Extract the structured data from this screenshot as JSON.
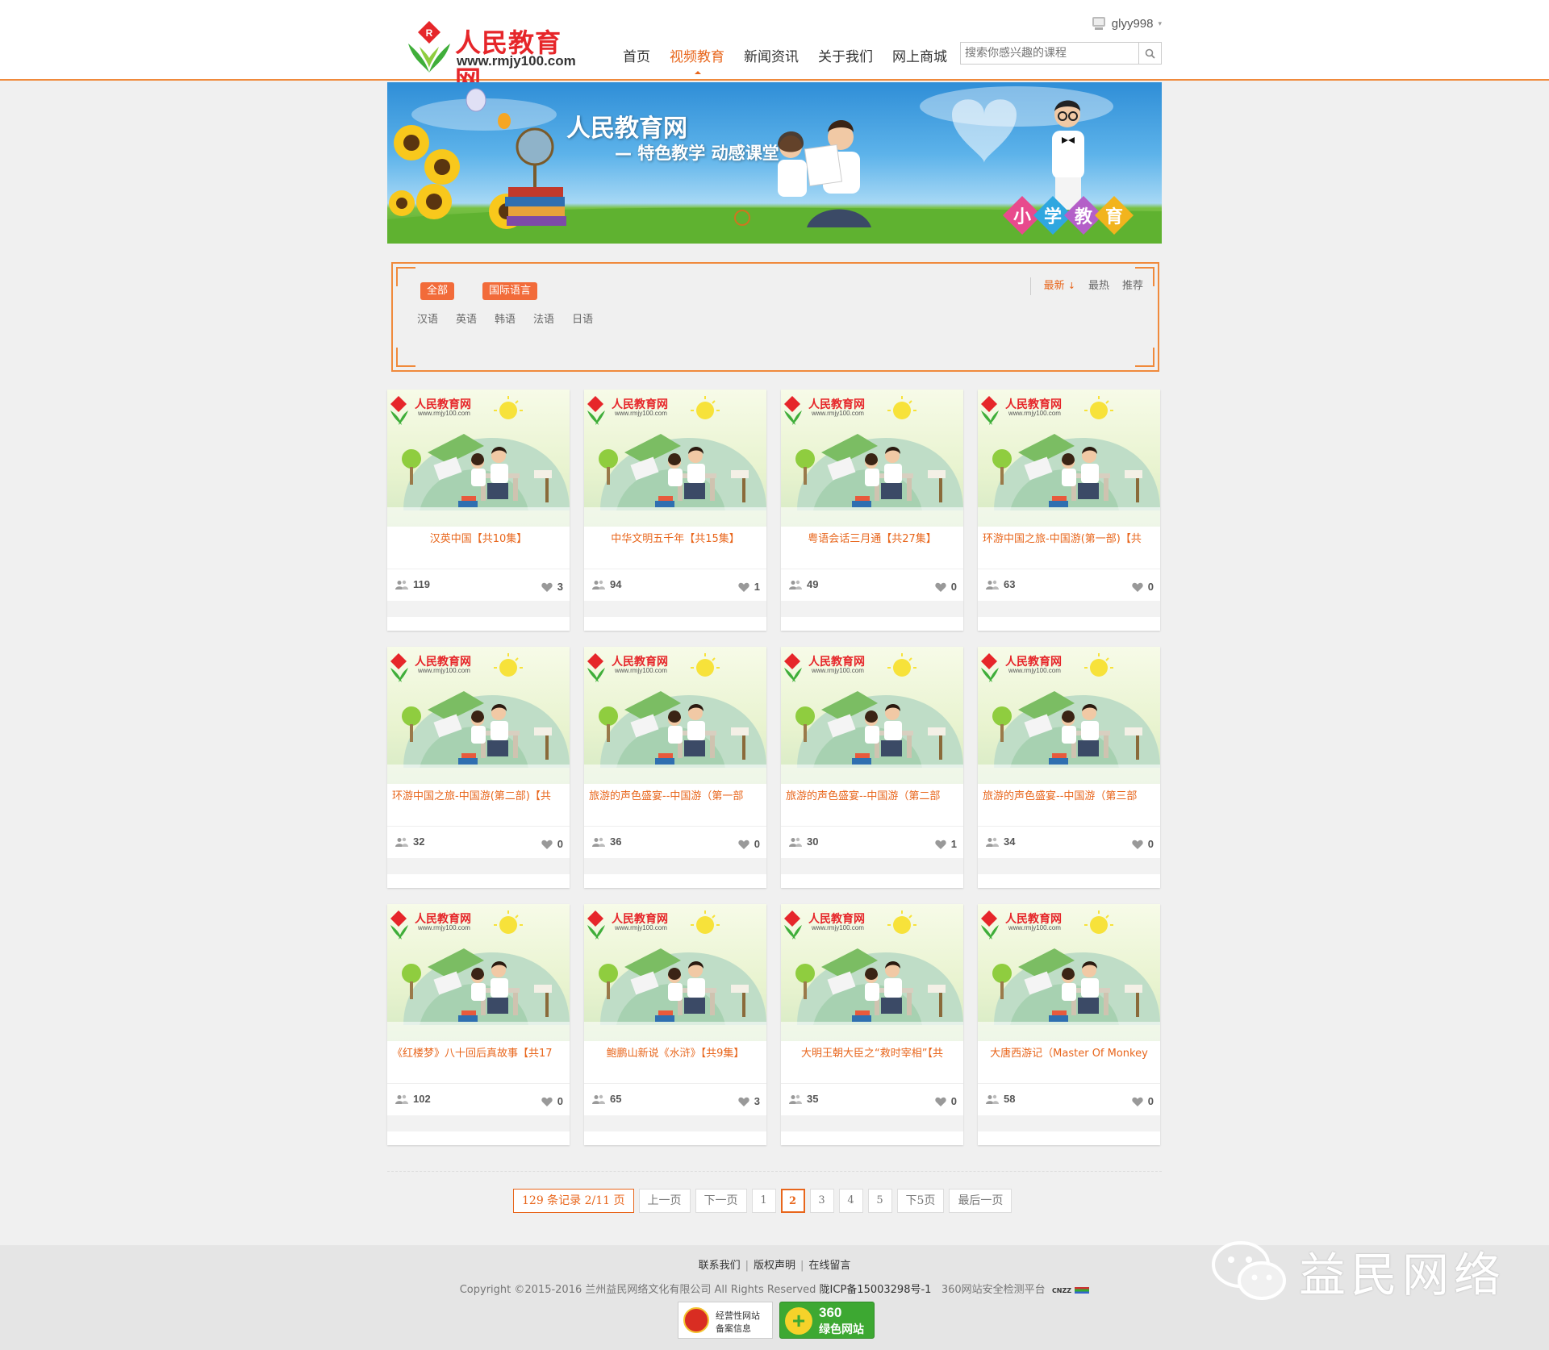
{
  "header": {
    "logo_title": "人民教育网",
    "logo_url": "www.rmjy100.com",
    "nav": [
      {
        "label": "首页",
        "active": false
      },
      {
        "label": "视频教育",
        "active": true
      },
      {
        "label": "新闻资讯",
        "active": false
      },
      {
        "label": "关于我们",
        "active": false
      },
      {
        "label": "网上商城",
        "active": false
      }
    ],
    "username": "glyy998",
    "search_placeholder": "搜索你感兴趣的课程"
  },
  "banner": {
    "title": "人民教育网",
    "subtitle": "— 特色教学  动感课堂",
    "badge_chars": [
      "小",
      "学",
      "教",
      "育"
    ]
  },
  "filter": {
    "tags": [
      "全部",
      "国际语言"
    ],
    "sub_categories": [
      "汉语",
      "英语",
      "韩语",
      "法语",
      "日语"
    ],
    "sort": [
      {
        "label": "最新",
        "active": true,
        "arrow": "↓"
      },
      {
        "label": "最热",
        "active": false
      },
      {
        "label": "推荐",
        "active": false
      }
    ]
  },
  "thumb": {
    "logo": "人民教育网",
    "url": "www.rmjy100.com"
  },
  "courses": [
    {
      "title": "汉英中国【共10集】",
      "views": "119",
      "likes": "3"
    },
    {
      "title": "中华文明五千年【共15集】",
      "views": "94",
      "likes": "1"
    },
    {
      "title": "粤语会话三月通【共27集】",
      "views": "49",
      "likes": "0"
    },
    {
      "title": "环游中国之旅-中国游(第一部)【共",
      "views": "63",
      "likes": "0"
    },
    {
      "title": "环游中国之旅-中国游(第二部)【共",
      "views": "32",
      "likes": "0"
    },
    {
      "title": "旅游的声色盛宴--中国游（第一部",
      "views": "36",
      "likes": "0"
    },
    {
      "title": "旅游的声色盛宴--中国游（第二部",
      "views": "30",
      "likes": "1"
    },
    {
      "title": "旅游的声色盛宴--中国游（第三部",
      "views": "34",
      "likes": "0"
    },
    {
      "title": "《红楼梦》八十回后真故事【共17",
      "views": "102",
      "likes": "0"
    },
    {
      "title": "鲍鹏山新说《水浒》【共9集】",
      "views": "65",
      "likes": "3"
    },
    {
      "title": "大明王朝大臣之“救时宰相”【共",
      "views": "35",
      "likes": "0"
    },
    {
      "title": "大唐西游记（Master Of Monkey",
      "views": "58",
      "likes": "0"
    }
  ],
  "pagination": {
    "info": "129 条记录  2/11 页",
    "prev": "上一页",
    "next": "下一页",
    "pages": [
      "1",
      "2",
      "3",
      "4",
      "5"
    ],
    "current": "2",
    "next5": "下5页",
    "last": "最后一页"
  },
  "footer": {
    "links": [
      "联系我们",
      "版权声明",
      "在线留言"
    ],
    "copyright": "Copyright ©2015-2016 兰州益民网络文化有限公司 All Rights Reserved",
    "icp": "陇ICP备15003298号-1",
    "security": "360网站安全检测平台",
    "cnzz": "CNZZ",
    "badge1_line1": "经营性网站",
    "badge1_line2": "备案信息",
    "badge2_line1": "360",
    "badge2_line2": "绿色网站"
  },
  "watermark": "益民网络",
  "colors": {
    "accent": "#e8661c",
    "tag": "#f26b3a",
    "brand_red": "#e6262a",
    "green": "#3da832"
  }
}
